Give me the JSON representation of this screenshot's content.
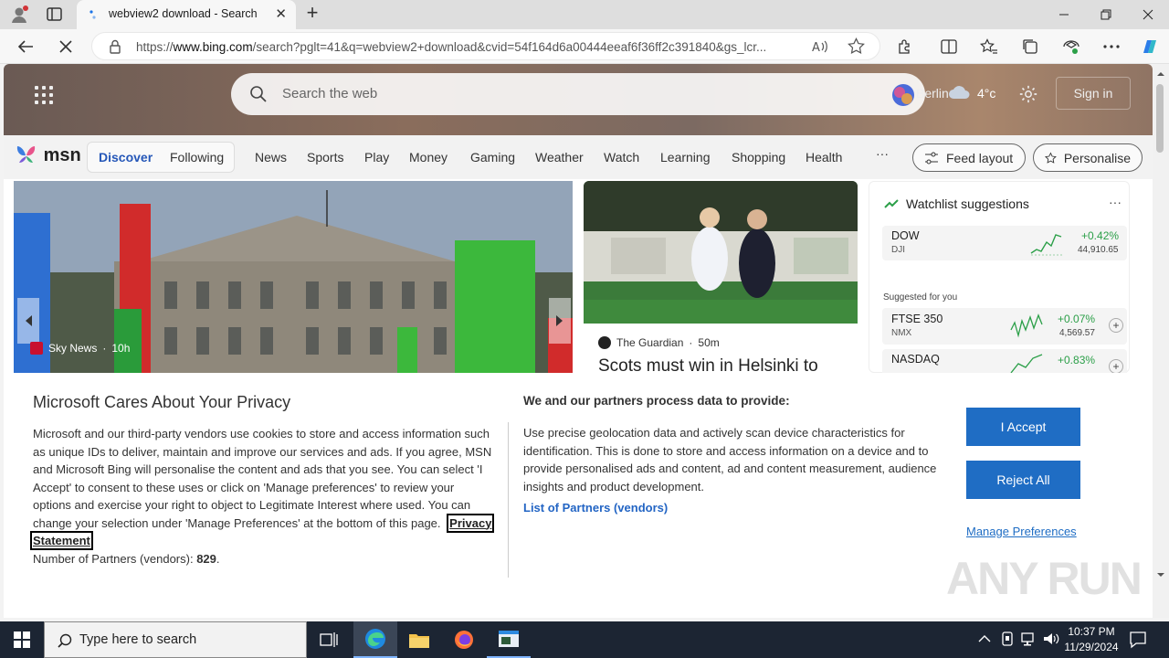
{
  "browser": {
    "tab_title": "webview2 download - Search",
    "url_prefix": "https://",
    "url_host": "www.bing.com",
    "url_rest": "/search?pglt=41&q=webview2+download&cvid=54f164d6a00444eeaf6f36ff2c391840&gs_lcr..."
  },
  "msn_header": {
    "search_placeholder": "Search the web",
    "location": "Berlin",
    "temperature": "4°c",
    "sign_in": "Sign in"
  },
  "msn_nav": {
    "logo": "msn",
    "discover": "Discover",
    "following": "Following",
    "links": [
      "News",
      "Sports",
      "Play",
      "Money",
      "Gaming",
      "Weather",
      "Watch",
      "Learning",
      "Shopping",
      "Health"
    ],
    "more": "···",
    "feed_layout": "Feed layout",
    "personalise": "Personalise"
  },
  "cards": {
    "main": {
      "source": "Sky News",
      "age": "10h"
    },
    "sport": {
      "source": "The Guardian",
      "age": "50m",
      "headline": "Scots must win in Helsinki to"
    },
    "watchlist": {
      "title": "Watchlist suggestions",
      "more": "···",
      "suggested_label": "Suggested for you",
      "items": [
        {
          "name": "DOW",
          "sub": "DJI",
          "change": "+0.42%",
          "value": "44,910.65"
        },
        {
          "name": "FTSE 350",
          "sub": "NMX",
          "change": "+0.07%",
          "value": "4,569.57"
        },
        {
          "name": "NASDAQ",
          "sub": "",
          "change": "+0.83%",
          "value": ""
        }
      ]
    }
  },
  "privacy": {
    "title": "Microsoft Cares About Your Privacy",
    "body": "Microsoft and our third-party vendors use cookies to store and access information such as unique IDs to deliver, maintain and improve our services and ads. If you agree, MSN and Microsoft Bing will personalise the content and ads that you see. You can select 'I Accept' to consent to these uses or click on 'Manage preferences' to review your options and exercise your right to object to Legitimate Interest where used.  You can change your selection under 'Manage Preferences' at the bottom of this page.",
    "privacy_link": "Privacy Statement",
    "partners_label": "Number of Partners (vendors):",
    "partners_count": "829",
    "right_title": "We and our partners process data to provide:",
    "right_body": "Use precise geolocation data and actively scan device characteristics for identification. This is done to store and access information on a device and to provide personalised ads and content, ad and content measurement, audience insights and product development.",
    "partners_link": "List of Partners (vendors)",
    "accept": "I Accept",
    "reject": "Reject All",
    "manage": "Manage Preferences"
  },
  "watermark": "ANY RUN",
  "taskbar": {
    "search_placeholder": "Type here to search",
    "time": "10:37 PM",
    "date": "11/29/2024"
  },
  "colors": {
    "accent": "#1f6dc4",
    "link": "#2365c4",
    "taskbar": "#1c2533"
  }
}
